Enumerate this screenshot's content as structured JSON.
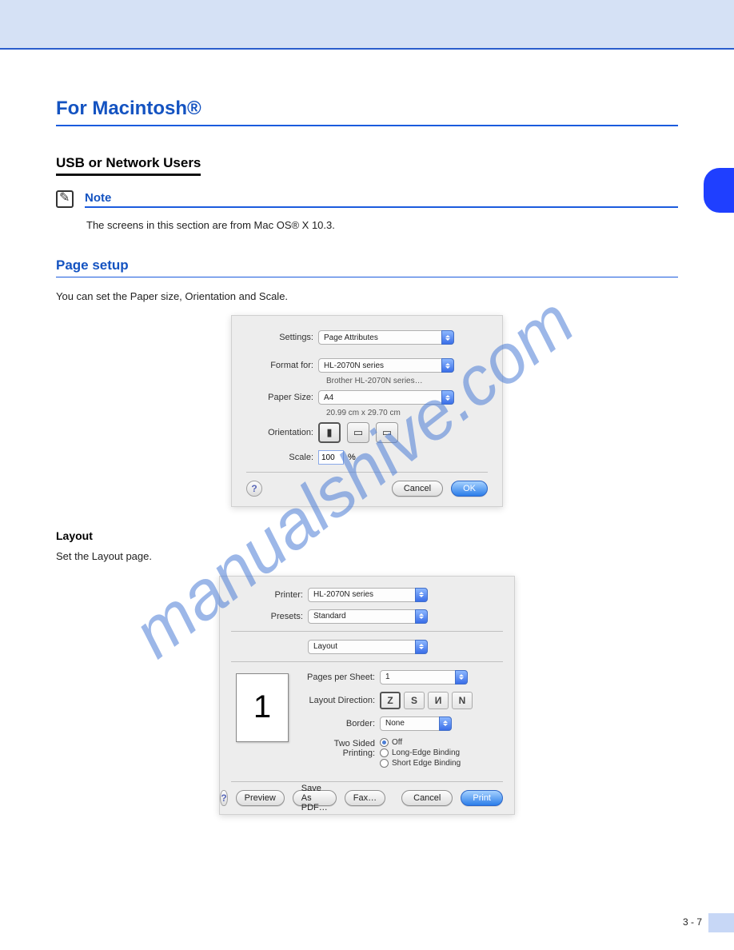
{
  "page_number": "3 - 7",
  "h1": "For Macintosh®",
  "h2": "USB or Network Users",
  "note_label": "Note",
  "note_body": "The screens in this section are from Mac OS® X 10.3.",
  "h3": "Page setup",
  "body1": "You can set the Paper size, Orientation and Scale.",
  "dlg1": {
    "settings_label": "Settings:",
    "settings_value": "Page Attributes",
    "format_label": "Format for:",
    "format_value": "HL-2070N series",
    "format_sub": "Brother HL-2070N series…",
    "paper_label": "Paper Size:",
    "paper_value": "A4",
    "paper_sub": "20.99 cm x 29.70 cm",
    "orient_label": "Orientation:",
    "scale_label": "Scale:",
    "scale_value": "100",
    "percent": "%",
    "cancel": "Cancel",
    "ok": "OK"
  },
  "body2": "Layout",
  "body2b": "Set the Layout page.",
  "dlg2": {
    "printer_label": "Printer:",
    "printer_value": "HL-2070N series",
    "presets_label": "Presets:",
    "presets_value": "Standard",
    "panel_value": "Layout",
    "pps_label": "Pages per Sheet:",
    "pps_value": "1",
    "ld_label": "Layout Direction:",
    "border_label": "Border:",
    "border_value": "None",
    "twosided_label": "Two Sided Printing:",
    "r_off": "Off",
    "r_long": "Long-Edge Binding",
    "r_short": "Short Edge Binding",
    "preview": "Preview",
    "saveas": "Save As PDF…",
    "fax": "Fax…",
    "cancel": "Cancel",
    "print": "Print",
    "preview_num": "1"
  },
  "watermark_text": "manualshive.com"
}
